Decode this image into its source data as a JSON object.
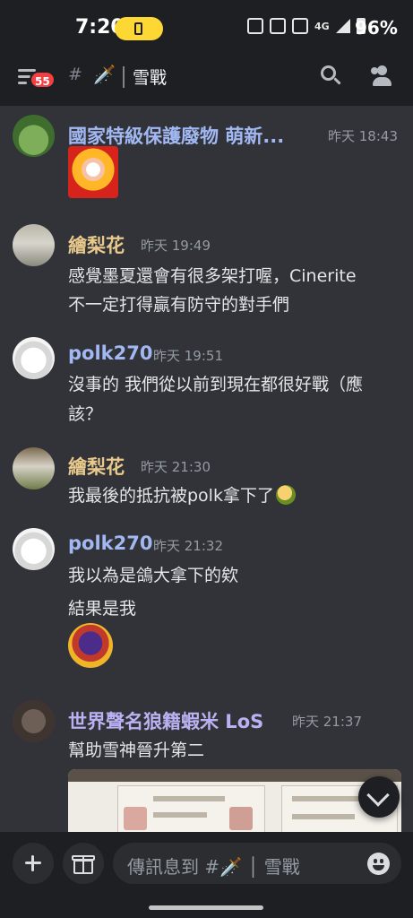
{
  "status_bar": {
    "time": "7:20",
    "network": "4G",
    "battery": "96%"
  },
  "header": {
    "notification_count": "55",
    "hash": "#",
    "channel_emoji": "🗡️",
    "channel_name": "雪戰"
  },
  "messages": [
    {
      "username": "國家特級保護廢物 萌新...",
      "timestamp": "昨天 18:43",
      "name_color": "#a2b8f3",
      "lines": []
    },
    {
      "username": "繪梨花",
      "timestamp": "昨天 19:49",
      "name_color": "#e9ca8c",
      "lines": [
        "感覺墨夏還會有很多架打喔，Cinerite",
        "不一定打得贏有防守的對手們"
      ]
    },
    {
      "username": "polk270",
      "timestamp": "昨天 19:51",
      "name_color": "#a2b8f3",
      "lines": [
        "沒事的 我們從以前到現在都很好戰（應",
        "該？"
      ]
    },
    {
      "username": "繪梨花",
      "timestamp": "昨天 21:30",
      "name_color": "#e9ca8c",
      "lines": [
        "我最後的抵抗被polk拿下了"
      ]
    },
    {
      "username": "polk270",
      "timestamp": "昨天 21:32",
      "name_color": "#a2b8f3",
      "lines": [
        "我以為是鴿大拿下的欸",
        "結果是我"
      ]
    },
    {
      "username": "世界聲名狼籍蝦米 LoS",
      "timestamp": "昨天 21:37",
      "name_color": "#b9b1f1",
      "lines": [
        "幫助雪神晉升第二"
      ]
    }
  ],
  "composer": {
    "placeholder": "傳訊息到 #🗡️ │ 雪戰"
  }
}
